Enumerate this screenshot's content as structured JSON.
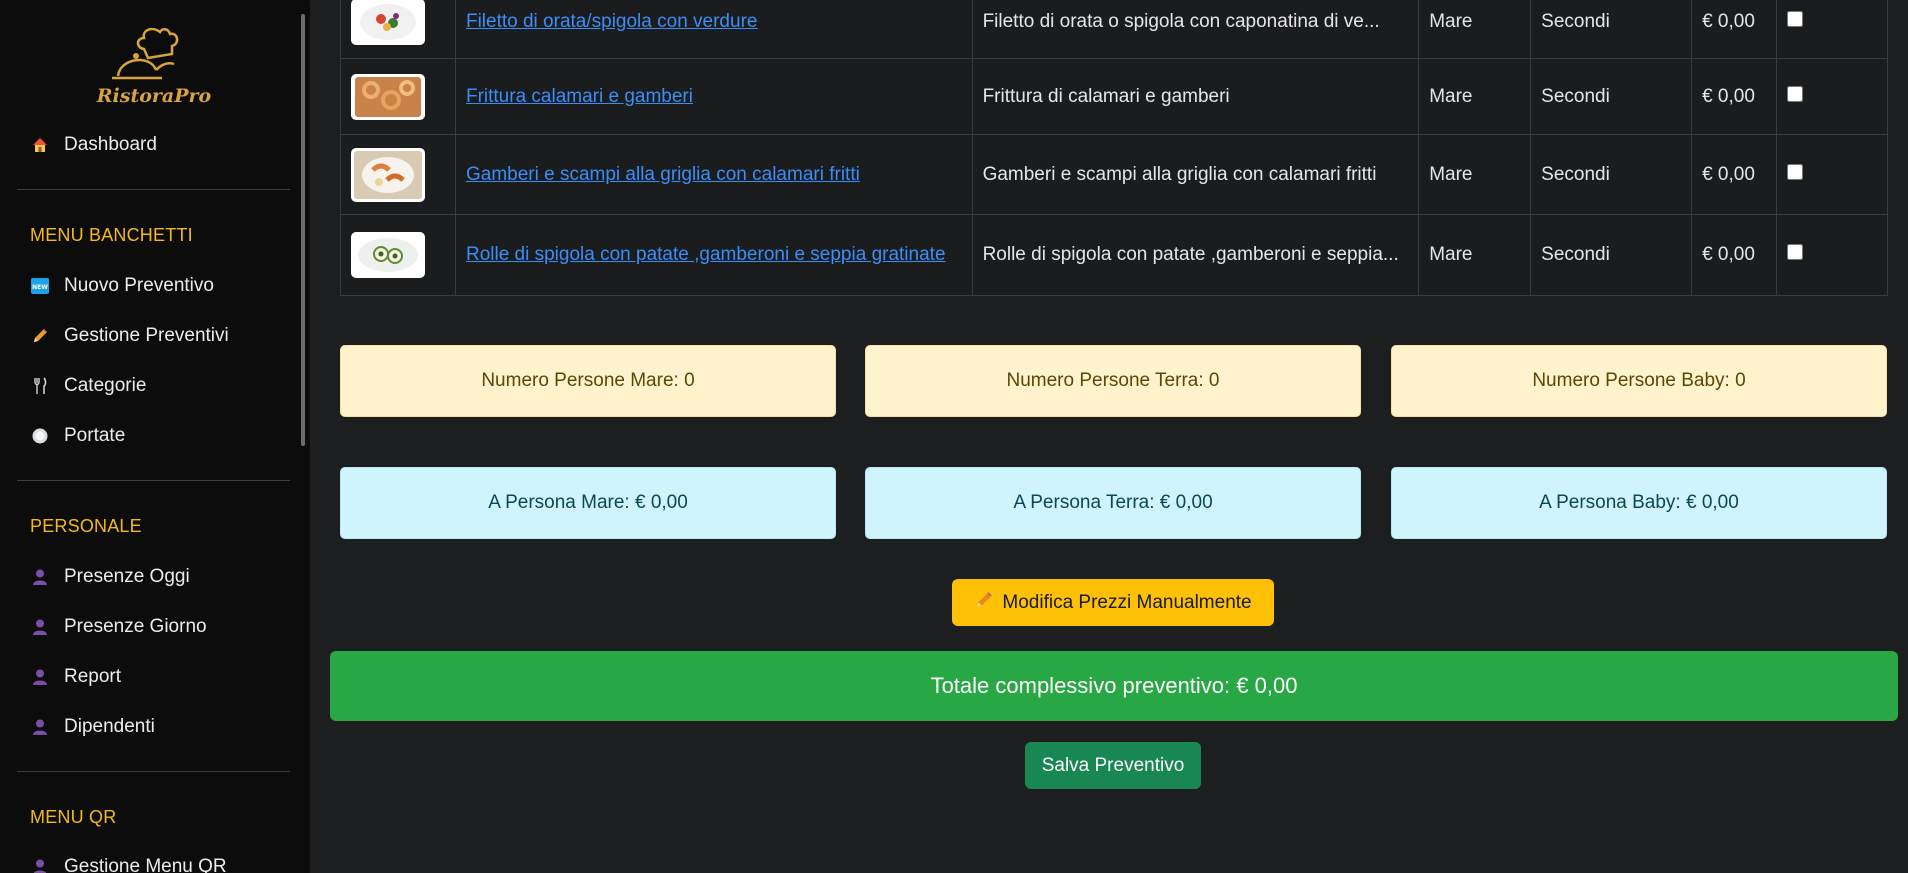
{
  "sidebar": {
    "logo_text": "RistoraPro",
    "dashboard": "Dashboard",
    "sections": {
      "banchetti": "MENU BANCHETTI",
      "personale": "PERSONALE",
      "qr": "MENU QR"
    },
    "banchetti_items": [
      "Nuovo Preventivo",
      "Gestione Preventivi",
      "Categorie",
      "Portate"
    ],
    "personale_items": [
      "Presenze Oggi",
      "Presenze Giorno",
      "Report",
      "Dipendenti"
    ],
    "qr_items": [
      "Gestione Menu QR"
    ]
  },
  "dishes": [
    {
      "name": "Filetto di orata/spigola con verdure",
      "description": "Filetto di orata o spigola con caponatina di ve...",
      "type": "Mare",
      "category": "Secondi",
      "price": "€ 0,00",
      "checked": false
    },
    {
      "name": "Frittura calamari e gamberi",
      "description": "Frittura di calamari e gamberi",
      "type": "Mare",
      "category": "Secondi",
      "price": "€ 0,00",
      "checked": false
    },
    {
      "name": "Gamberi e scampi alla griglia con calamari fritti",
      "description": "Gamberi e scampi alla griglia con calamari fritti",
      "type": "Mare",
      "category": "Secondi",
      "price": "€ 0,00",
      "checked": false
    },
    {
      "name": "Rolle di spigola con patate ,gamberoni e seppia gratinate",
      "description": "Rolle di spigola con patate ,gamberoni e seppia...",
      "type": "Mare",
      "category": "Secondi",
      "price": "€ 0,00",
      "checked": false
    }
  ],
  "counts": {
    "mare": "Numero Persone Mare: 0",
    "terra": "Numero Persone Terra: 0",
    "baby": "Numero Persone Baby: 0"
  },
  "per_person": {
    "mare": "A Persona Mare: € 0,00",
    "terra": "A Persona Terra: € 0,00",
    "baby": "A Persona Baby: € 0,00"
  },
  "buttons": {
    "manual_prices": "Modifica Prezzi Manualmente",
    "save": "Salva Preventivo"
  },
  "total": "Totale complessivo preventivo: € 0,00",
  "colors": {
    "accent_gold": "#f5b91a",
    "warning_bg": "#fff3cd",
    "info_bg": "#cff4fc",
    "success": "#28a745",
    "save_green": "#198754",
    "link_blue": "#3a8ef6"
  }
}
